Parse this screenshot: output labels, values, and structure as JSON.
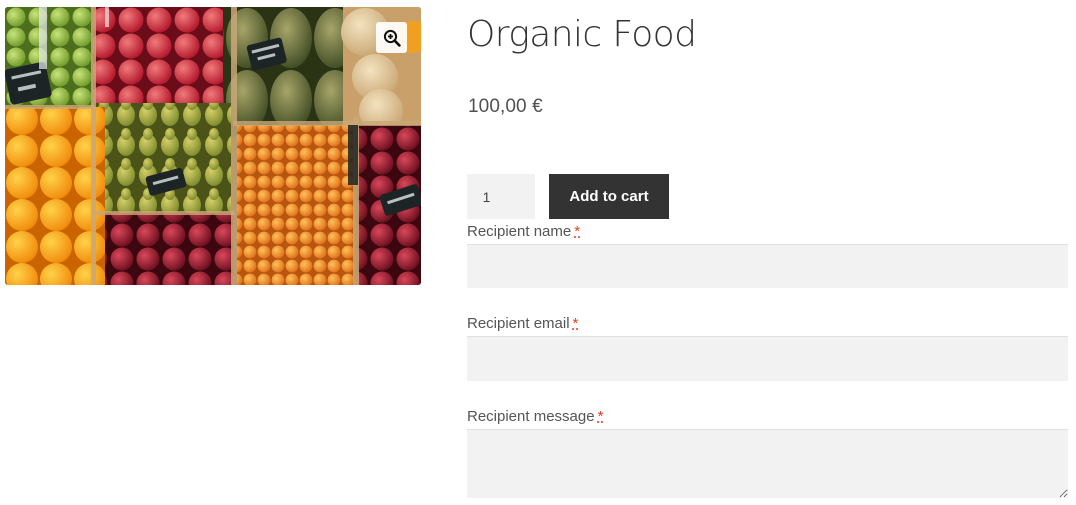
{
  "product": {
    "title": "Organic Food",
    "price": "100,00 €",
    "image_alt": "Fruit market stalls with apples, pomegranates, pears, melons, apricots and oranges"
  },
  "gallery": {
    "zoom_icon": "zoom-in-icon"
  },
  "cart": {
    "quantity": "1",
    "add_to_cart_label": "Add to cart"
  },
  "gift_form": {
    "required_marker": "*",
    "recipient_name_label": "Recipient name",
    "recipient_name_value": "",
    "recipient_email_label": "Recipient email",
    "recipient_email_value": "",
    "recipient_message_label": "Recipient message",
    "recipient_message_value": ""
  },
  "colors": {
    "button_bg": "#333333",
    "input_bg": "#f2f2f2",
    "required": "#e2401c"
  }
}
